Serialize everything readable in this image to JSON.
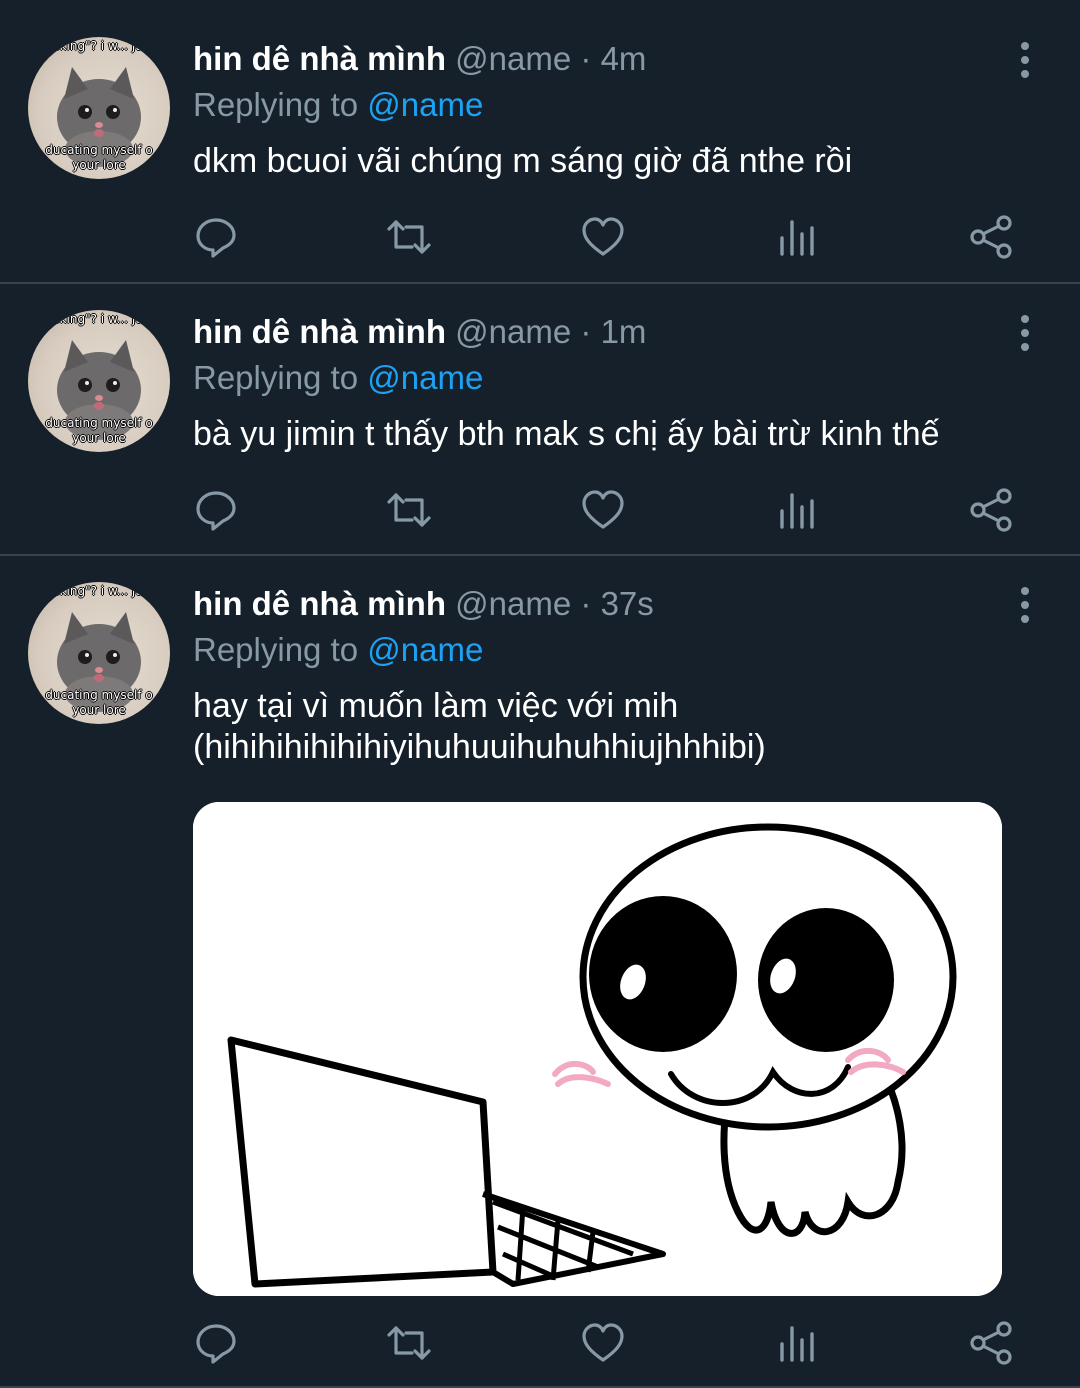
{
  "avatar_text": {
    "top": "talking\"? i w... just",
    "bottom_1": "ducating myself o",
    "bottom_2": "your lore"
  },
  "tweets": [
    {
      "name": "hin dê nhà mình",
      "handle": "@name",
      "dot": "·",
      "time": "4m",
      "replying_label": "Replying to",
      "replying_to": "@name",
      "text": "dkm bcuoi vãi chúng m sáng giờ đã nthe rồi"
    },
    {
      "name": "hin dê nhà mình",
      "handle": "@name",
      "dot": "·",
      "time": "1m",
      "replying_label": "Replying to",
      "replying_to": "@name",
      "text": "bà yu jimin t thấy bth mak s chị ấy bài trừ kinh thế"
    },
    {
      "name": "hin dê nhà mình",
      "handle": "@name",
      "dot": "·",
      "time": "37s",
      "replying_label": "Replying to",
      "replying_to": "@name",
      "text_line1": "hay tại vì muốn làm việc với mih",
      "text_line2": "(hihihihihihihiyihuhuuihuhuhhiujhhhibi)"
    }
  ],
  "colors": {
    "background": "#15202b",
    "divider": "#38444d",
    "secondary_text": "#8899a6",
    "mention": "#1da1f2"
  },
  "icons": [
    "reply-icon",
    "retweet-icon",
    "like-icon",
    "analytics-icon",
    "share-icon",
    "more-icon"
  ]
}
